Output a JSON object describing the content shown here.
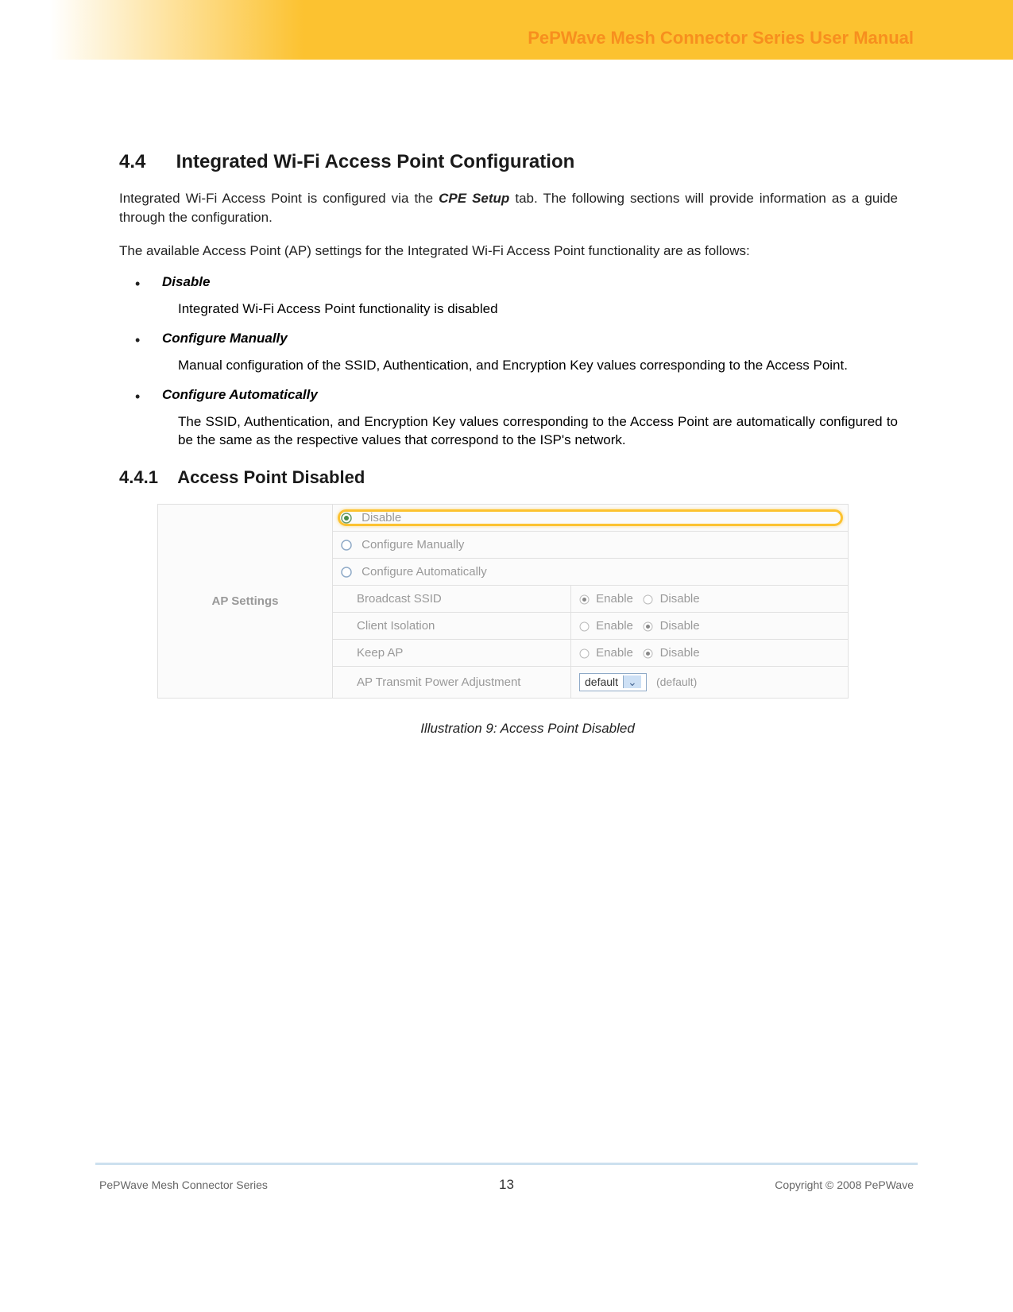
{
  "header": {
    "title": "PePWave Mesh Connector Series User Manual"
  },
  "section": {
    "number": "4.4",
    "title": "Integrated Wi-Fi Access Point Configuration",
    "intro_part1": "Integrated Wi-Fi Access Point is configured via the ",
    "intro_bold": "CPE Setup",
    "intro_part2": " tab.  The following sections will provide information as a guide through the configuration.",
    "para2": "The available Access Point (AP) settings for the Integrated Wi-Fi Access Point functionality are as follows:"
  },
  "bullets": [
    {
      "label": "Disable",
      "desc": "Integrated Wi-Fi Access Point functionality is disabled"
    },
    {
      "label": "Configure Manually",
      "desc": "Manual configuration of the SSID, Authentication, and Encryption Key values corresponding to the Access Point."
    },
    {
      "label": "Configure Automatically",
      "desc": "The SSID, Authentication, and Encryption Key values corresponding to the Access Point are automatically configured to be the same as the respective values that correspond to the ISP's network."
    }
  ],
  "subsection": {
    "number": "4.4.1",
    "title": "Access Point Disabled"
  },
  "screenshot": {
    "panel_title": "AP Settings",
    "radios": {
      "disable": "Disable",
      "manual": "Configure Manually",
      "auto": "Configure Automatically"
    },
    "rows": {
      "broadcast": {
        "label": "Broadcast SSID",
        "opt1": "Enable",
        "opt2": "Disable"
      },
      "isolation": {
        "label": "Client Isolation",
        "opt1": "Enable",
        "opt2": "Disable"
      },
      "keepap": {
        "label": "Keep AP",
        "opt1": "Enable",
        "opt2": "Disable"
      },
      "txpower": {
        "label": "AP Transmit Power Adjustment",
        "value": "default",
        "suffix": "(default)"
      }
    }
  },
  "illustration": {
    "caption": "Illustration 9: Access Point Disabled"
  },
  "footer": {
    "left": "PePWave  Mesh Connector Series",
    "center": "13",
    "right": "Copyright © 2008 PePWave"
  }
}
